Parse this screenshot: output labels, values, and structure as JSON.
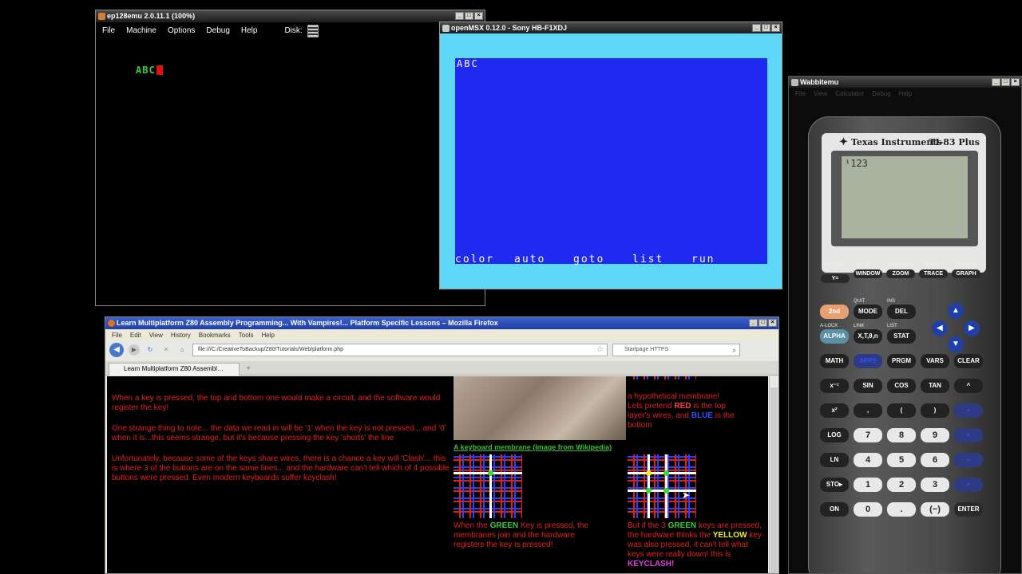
{
  "ep128": {
    "title": "ep128emu 2.0.11.1 (100%)",
    "menu": [
      "File",
      "Machine",
      "Options",
      "Debug",
      "Help"
    ],
    "disk_label": "Disk:",
    "screen_text": "ABC"
  },
  "msx": {
    "title": "openMSX 0.12.0 - Sony HB-F1XDJ",
    "screen_text": "ABC",
    "function_keys": [
      "color",
      "auto",
      "goto",
      "list",
      "run"
    ]
  },
  "wabbit": {
    "title": "Wabbitemu",
    "menu": [
      "File",
      "View",
      "Calculator",
      "Debug",
      "Help"
    ],
    "brand": "Texas Instruments",
    "model": "TI-83 Plus",
    "lcd_text": "¹123",
    "fn_keys": [
      {
        "top": "STAT PLOT F1",
        "label": "Y="
      },
      {
        "top": "TBLSET F2",
        "label": "WINDOW"
      },
      {
        "top": "FORMAT F3",
        "label": "ZOOM"
      },
      {
        "top": "CALC F4",
        "label": "TRACE"
      },
      {
        "top": "TABLE F5",
        "label": "GRAPH"
      }
    ],
    "row1": [
      "2nd",
      "MODE",
      "DEL"
    ],
    "row1_tops": [
      "QUIT",
      "INS"
    ],
    "row2": [
      "ALPHA",
      "X,T,θ,n",
      "STAT"
    ],
    "row2_tops": [
      "A-LOCK",
      "LINK",
      "LIST"
    ],
    "row3": [
      "MATH",
      "APPS",
      "PRGM",
      "VARS",
      "CLEAR"
    ],
    "row3_tops": [
      "TEST",
      "ANGLE",
      "DRAW",
      "DISTR"
    ],
    "row4": [
      "x⁻¹",
      "SIN",
      "COS",
      "TAN",
      "^"
    ],
    "row4_tops": [
      "MATRIX",
      "SIN⁻¹",
      "COS⁻¹",
      "TAN⁻¹",
      "π"
    ],
    "row5": [
      "x²",
      ",",
      "(",
      ")",
      "÷"
    ],
    "row5_tops": [
      "√",
      "EE",
      "{",
      "}",
      "e"
    ],
    "row6": [
      "LOG",
      "7",
      "8",
      "9",
      "×"
    ],
    "row6_tops": [
      "10ˣ",
      "u",
      "v",
      "w",
      "["
    ],
    "row7": [
      "LN",
      "4",
      "5",
      "6",
      "−"
    ],
    "row7_tops": [
      "eˣ",
      "L4",
      "L5",
      "L6",
      "]"
    ],
    "row8": [
      "STO▸",
      "1",
      "2",
      "3",
      "+"
    ],
    "row8_tops": [
      "RCL",
      "L1",
      "L2",
      "L3",
      "MEM"
    ],
    "row9": [
      "ON",
      "0",
      ".",
      "(−)",
      "ENTER"
    ],
    "row9_tops": [
      "OFF",
      "CATALOG",
      "i",
      "ANS",
      "ENTRY SOLVE"
    ]
  },
  "firefox": {
    "title": "Learn Multiplatform Z80 Assembly Programming... With Vampires!... Platform Specific Lessons – Mozilla Firefox",
    "menu": [
      "File",
      "Edit",
      "View",
      "History",
      "Bookmarks",
      "Tools",
      "Help"
    ],
    "url": "file:///C:/CreativeToBackup/Z80/Tutorials/Web/platform.php",
    "search_placeholder": "Startpage HTTPS",
    "tab_label": "Learn Multiplatform Z80 Assembl…",
    "new_tab": "+",
    "p1": "When a key is pressed, the top and bottom one would make a circuit, and the software would register the key!",
    "p2": "One strange thing to note... the data we read in will be '1' when the key is not pressed... and '0' when it is...this seems strange, but it's because pressing the key 'shorts' the line",
    "p3": "Unfortunately, because some of the keys share wires, there is a chance a key will 'Clash'... this is where 3 of the buttons are on the same lines... and the hardware can't tell which of 4 possible buttons were pressed.  Even modern keyboards suffer keyclash!",
    "caption": "A keyboard membrane (Image from Wikipedia)",
    "side1": "a hypothetical membrane!",
    "side2a": "Lets pretend ",
    "side2_red": "RED",
    "side2b": " is the top layer's wires,  and ",
    "side2_blue": "BLUE",
    "side2c": " is the bottom",
    "g1a": "When the ",
    "g1_green": "GREEN",
    "g1b": " Key is pressed, the membranes join and the hardware registers the key is pressed!",
    "g2a": "But if the 3 ",
    "g2_green": "GREEN",
    "g2b": " keys are pressed,  the hardware thinks the ",
    "g2_yellow": "YELLOW",
    "g2c": " key  was also pressed, it can't tell what keys were really down!  this is ",
    "g2_magenta": "KEYCLASH!"
  }
}
